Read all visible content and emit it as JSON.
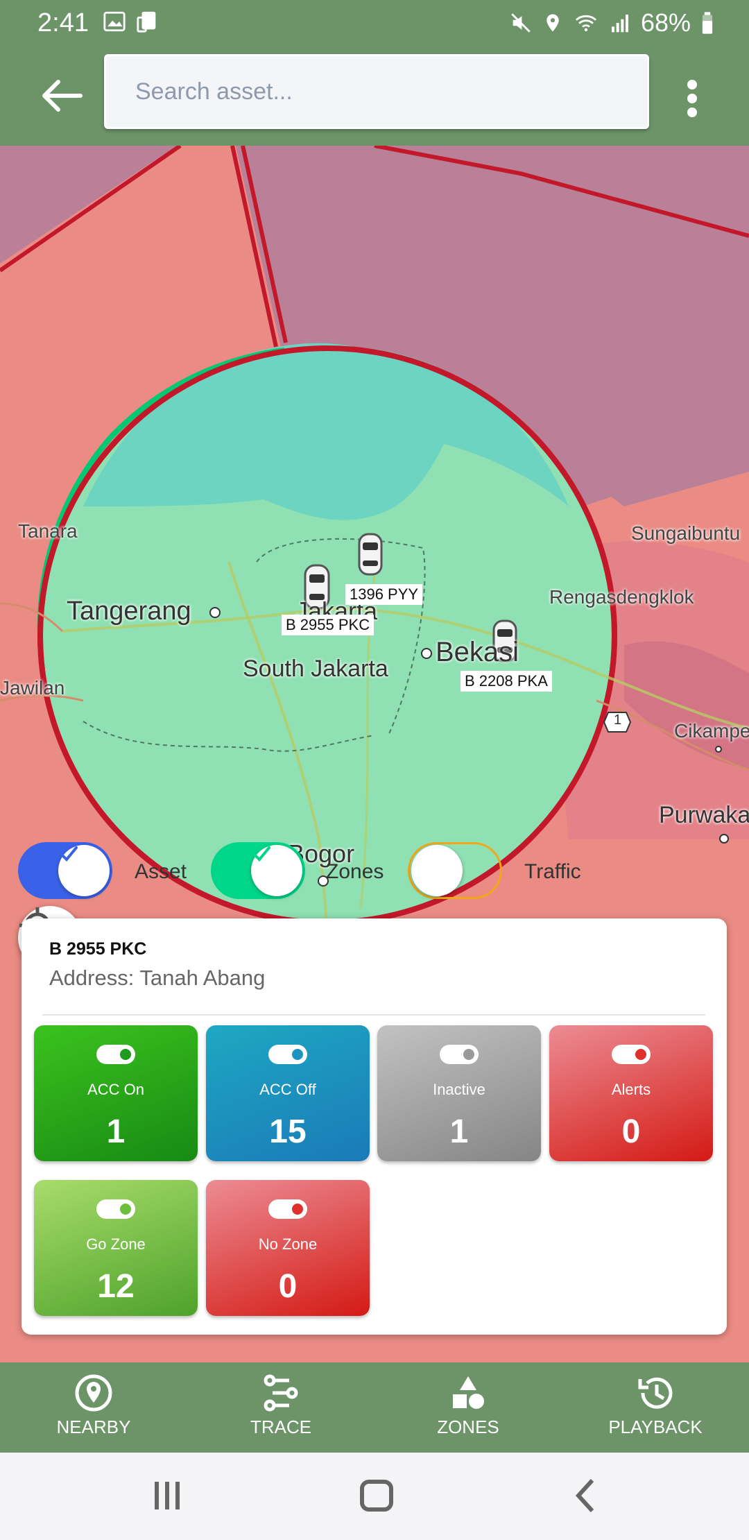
{
  "status_bar": {
    "time": "2:41",
    "battery": "68%"
  },
  "search": {
    "placeholder": "Search asset..."
  },
  "map": {
    "labels": {
      "tanara": "Tanara",
      "tangerang": "Tangerang",
      "south_jakarta": "South Jakarta",
      "jakarta": "Jakarta",
      "bekasi": "Bekasi",
      "sungaibuntu": "Sungaibuntu",
      "rengasdengklok": "Rengasdengklok",
      "jawilan": "Jawilan",
      "cikampek": "Cikampe",
      "purwakarta": "Purwaka",
      "bogor": "Bogor",
      "road_number": "1"
    },
    "vehicles": [
      {
        "plate": "B 2955 PKC"
      },
      {
        "plate": "B 1396 PYY"
      },
      {
        "plate": "B 2208 PKA"
      }
    ],
    "plate_labels": {
      "v1": "B 2955 PKC",
      "v2": "1396 PYY",
      "v3": "B 2208 PKA"
    }
  },
  "layers": {
    "asset": {
      "label": "Asset",
      "enabled": true,
      "color": "#3a62e8"
    },
    "zones": {
      "label": "Zones",
      "enabled": true,
      "color": "#00d68a"
    },
    "traffic": {
      "label": "Traffic",
      "enabled": false,
      "color": "#f0a818"
    }
  },
  "selected_asset": {
    "plate": "B 2955 PKC",
    "address": "Address: Tanah Abang"
  },
  "stats": [
    {
      "label": "ACC On",
      "count": "1",
      "color": "#1e9a1e"
    },
    {
      "label": "ACC Off",
      "count": "15",
      "color": "#1e94c0"
    },
    {
      "label": "Inactive",
      "count": "1",
      "color": "#9a9a9a"
    },
    {
      "label": "Alerts",
      "count": "0",
      "color": "#e0302c"
    },
    {
      "label": "Go Zone",
      "count": "12",
      "color": "#6cbf3a"
    },
    {
      "label": "No Zone",
      "count": "0",
      "color": "#e0302c"
    }
  ],
  "bottom_nav": {
    "nearby": "NEARBY",
    "trace": "TRACE",
    "zones": "ZONES",
    "playback": "PLAYBACK"
  }
}
